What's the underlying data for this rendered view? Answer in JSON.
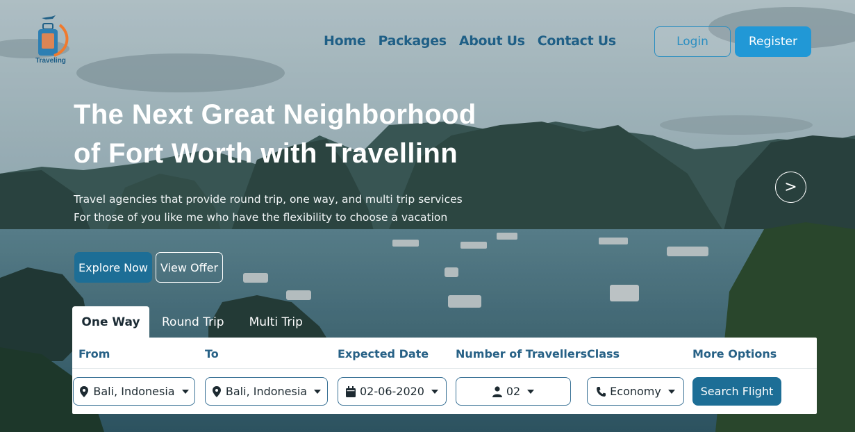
{
  "brand": {
    "name": "Traveling"
  },
  "nav": {
    "items": [
      "Home",
      "Packages",
      "About Us",
      "Contact Us"
    ]
  },
  "auth": {
    "login_label": "Login",
    "register_label": "Register"
  },
  "hero": {
    "title_line1": "The Next Great Neighborhood",
    "title_line2": "of Fort Worth with Travellinn",
    "subtitle_line1": "Travel agencies that provide round trip, one way, and multi trip services",
    "subtitle_line2": "For those of you like me who have the flexibility to choose a vacation",
    "explore_label": "Explore Now",
    "offer_label": "View Offer",
    "next_icon": "chevron-right-icon",
    "next_glyph": ">"
  },
  "tabs": [
    "One Way",
    "Round Trip",
    "Multi Trip"
  ],
  "active_tab": "One Way",
  "search": {
    "labels": {
      "from": "From",
      "to": "To",
      "date": "Expected Date",
      "travellers": "Number of Travellers",
      "class": "Class",
      "more": "More Options"
    },
    "from_value": "Bali, Indonesia",
    "to_value": "Bali, Indonesia",
    "date_value": "02-06-2020",
    "travellers_value": "02",
    "class_value": "Economy",
    "search_label": "Search Flight"
  },
  "colors": {
    "accent": "#2198d6",
    "primary_dark": "#1d6e96",
    "nav_text": "#1f5f86",
    "label_text": "#276186"
  }
}
